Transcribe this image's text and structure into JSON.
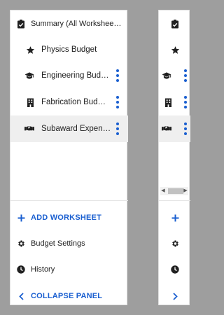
{
  "worksheets": {
    "summary": {
      "label": "Summary (All Worksheets)",
      "icon": "clipboard-check-icon"
    },
    "items": [
      {
        "label": "Physics Budget",
        "icon": "star-icon"
      },
      {
        "label": "Engineering Budget",
        "icon": "graduation-cap-icon"
      },
      {
        "label": "Fabrication Budget...",
        "icon": "building-icon"
      },
      {
        "label": "Subaward Expenses",
        "icon": "handshake-icon"
      }
    ]
  },
  "actions": {
    "add_worksheet": "ADD WORKSHEET",
    "budget_settings": "Budget Settings",
    "history": "History",
    "collapse_panel": "COLLAPSE PANEL"
  },
  "colors": {
    "accent": "#1a5fd0",
    "selected_bg": "#efefef",
    "background": "#9e9e9e"
  }
}
